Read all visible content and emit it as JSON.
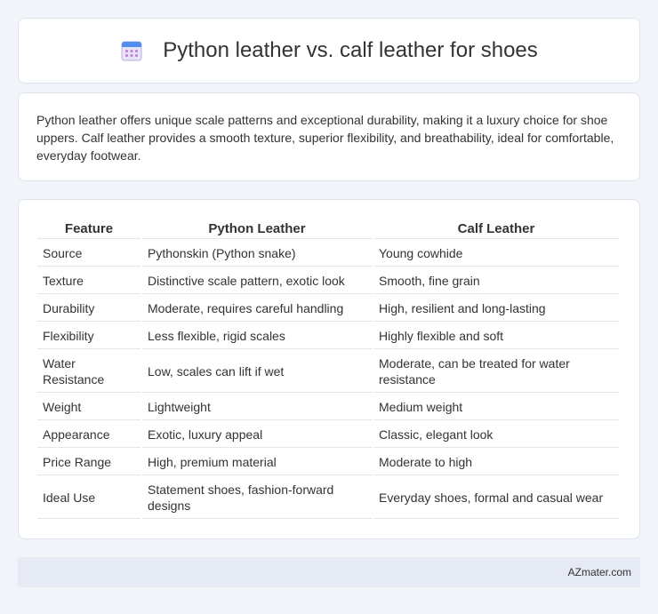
{
  "header": {
    "title": "Python leather vs. calf leather for shoes",
    "icon": "calendar-icon"
  },
  "intro": {
    "text": "Python leather offers unique scale patterns and exceptional durability, making it a luxury choice for shoe uppers. Calf leather provides a smooth texture, superior flexibility, and breathability, ideal for comfortable, everyday footwear."
  },
  "table": {
    "headers": [
      "Feature",
      "Python Leather",
      "Calf Leather"
    ],
    "rows": [
      [
        "Source",
        "Pythonskin (Python snake)",
        "Young cowhide"
      ],
      [
        "Texture",
        "Distinctive scale pattern, exotic look",
        "Smooth, fine grain"
      ],
      [
        "Durability",
        "Moderate, requires careful handling",
        "High, resilient and long-lasting"
      ],
      [
        "Flexibility",
        "Less flexible, rigid scales",
        "Highly flexible and soft"
      ],
      [
        "Water Resistance",
        "Low, scales can lift if wet",
        "Moderate, can be treated for water resistance"
      ],
      [
        "Weight",
        "Lightweight",
        "Medium weight"
      ],
      [
        "Appearance",
        "Exotic, luxury appeal",
        "Classic, elegant look"
      ],
      [
        "Price Range",
        "High, premium material",
        "Moderate to high"
      ],
      [
        "Ideal Use",
        "Statement shoes, fashion-forward designs",
        "Everyday shoes, formal and casual wear"
      ]
    ]
  },
  "footer": {
    "brand": "AZmater.com"
  }
}
